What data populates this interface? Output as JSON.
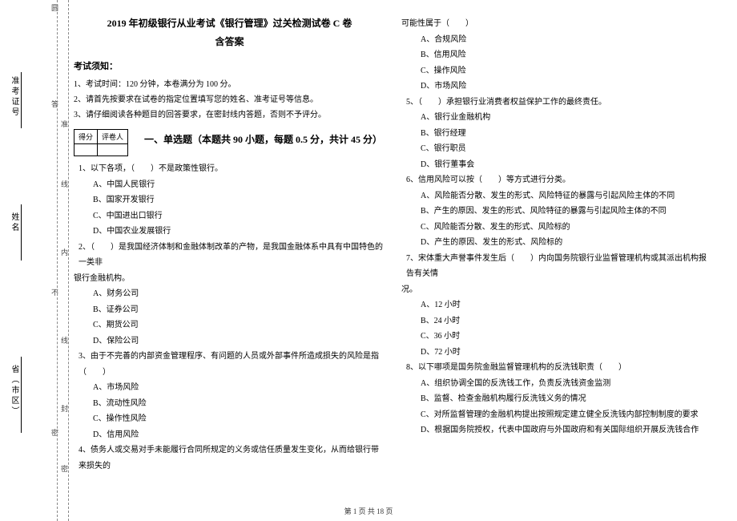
{
  "binding": {
    "b1": "圆",
    "b2": "答",
    "b3": "不",
    "b4": "密"
  },
  "binding_marks": {
    "m1": "准",
    "m2": "内",
    "m3": "线",
    "m4": "封",
    "m5": "密"
  },
  "vfields": {
    "ticket": "准考证号",
    "name": "姓名",
    "province": "省（市区）"
  },
  "header": {
    "title": "2019 年初级银行从业考试《银行管理》过关检测试卷 C 卷",
    "subtitle": "含答案"
  },
  "notice": {
    "head": "考试须知：",
    "lines": [
      "1、考试时间：120 分钟，本卷满分为 100 分。",
      "2、请首先按要求在试卷的指定位置填写您的姓名、准考证号等信息。",
      "3、请仔细阅读各种题目的回答要求，在密封线内答题，否则不予评分。"
    ]
  },
  "score_table": {
    "c1": "得分",
    "c2": "评卷人"
  },
  "section1": "一、单选题（本题共 90 小题，每题 0.5 分，共计 45 分）",
  "left_questions": [
    {
      "stem": "1、以下各项，（　　）不是政策性银行。",
      "opts": [
        "A、中国人民银行",
        "B、国家开发银行",
        "C、中国进出口银行",
        "D、中国农业发展银行"
      ]
    },
    {
      "stem": "2、（　　）是我国经济体制和金融体制改革的产物，是我国金融体系中具有中国特色的一类非",
      "cont": "银行金融机构。",
      "opts": [
        "A、财务公司",
        "B、证券公司",
        "C、期货公司",
        "D、保险公司"
      ]
    },
    {
      "stem": "3、由于不完善的内部资金管理程序、有问题的人员或外部事件所造成损失的风险是指（　　）",
      "opts": [
        "A、市场风险",
        "B、流动性风险",
        "C、操作性风险",
        "D、信用风险"
      ]
    },
    {
      "stem": "4、债务人或交易对手未能履行合同所规定的义务或信任质量发生变化，从而给银行带来损失的"
    }
  ],
  "right_questions": [
    {
      "cont": "可能性属于（　　）",
      "opts": [
        "A、合规风险",
        "B、信用风险",
        "C、操作风险",
        "D、市场风险"
      ]
    },
    {
      "stem": "5、（　　）承担银行业消费者权益保护工作的最终责任。",
      "opts": [
        "A、银行业金融机构",
        "B、银行经理",
        "C、银行职员",
        "D、银行董事会"
      ]
    },
    {
      "stem": "6、信用风险可以按（　　）等方式进行分类。",
      "opts": [
        "A、风险能否分散、发生的形式、风险特征的暴露与引起风险主体的不同",
        "B、产生的原因、发生的形式、风险特征的暴露与引起风险主体的不同",
        "C、风险能否分散、发生的形式、风险标的",
        "D、产生的原因、发生的形式、风险标的"
      ]
    },
    {
      "stem": "7、宋体重大声誉事件发生后（　　）内向国务院银行业监督管理机构或其派出机构报告有关情",
      "cont": "况。",
      "opts": [
        "A、12 小时",
        "B、24 小时",
        "C、36 小时",
        "D、72 小时"
      ]
    },
    {
      "stem": "8、以下哪项是国务院金融监督管理机构的反洗钱职责（　　）",
      "opts": [
        "A、组织协调全国的反洗钱工作，负责反洗钱资金监测",
        "B、监督、检查金融机构履行反洗钱义务的情况",
        "C、对所监督管理的金融机构提出按照规定建立健全反洗钱内部控制制度的要求",
        "D、根据国务院授权，代表中国政府与外国政府和有关国际组织开展反洗钱合作"
      ]
    }
  ],
  "footer": "第 1 页 共 18 页"
}
